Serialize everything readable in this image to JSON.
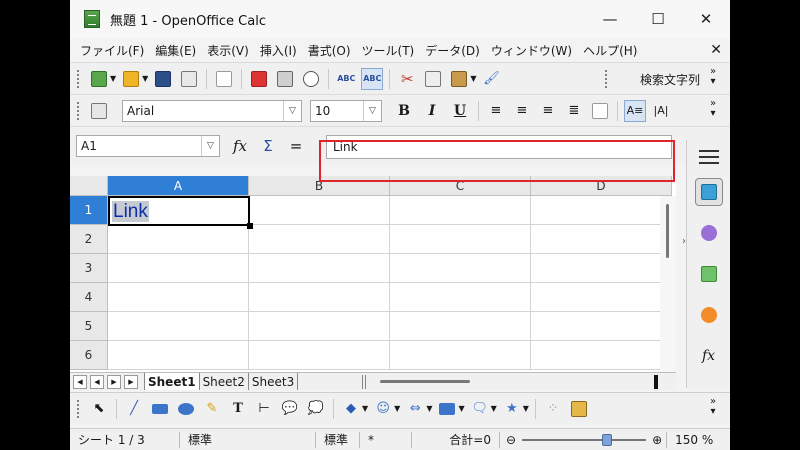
{
  "window": {
    "title": "無題 1 - OpenOffice Calc",
    "controls": {
      "minimize": "—",
      "maximize": "☐",
      "close": "✕"
    }
  },
  "menubar": {
    "items": [
      "ファイル(F)",
      "編集(E)",
      "表示(V)",
      "挿入(I)",
      "書式(O)",
      "ツール(T)",
      "データ(D)",
      "ウィンドウ(W)",
      "ヘルプ(H)"
    ],
    "close": "✕"
  },
  "standard_toolbar": {
    "find_label": "検索文字列",
    "buttons": [
      "new-icon",
      "open-icon",
      "save-icon",
      "email-icon",
      "edit-file-icon",
      "export-pdf-icon",
      "print-icon",
      "page-preview-icon",
      "spellcheck-icon",
      "autospellcheck-icon",
      "cut-icon",
      "copy-icon",
      "paste-icon",
      "format-paintbrush-icon"
    ]
  },
  "format_toolbar": {
    "font_name": "Arial",
    "font_size": "10",
    "bold": "B",
    "italic": "I",
    "underline": "U"
  },
  "formula_bar": {
    "name_box": "A1",
    "fx": "fx",
    "sum": "Σ",
    "equals": "=",
    "input_value": "Link"
  },
  "grid": {
    "columns": [
      "A",
      "B",
      "C",
      "D"
    ],
    "rows": [
      "1",
      "2",
      "3",
      "4",
      "5",
      "6"
    ],
    "active_cell_text": "Link"
  },
  "sheets": {
    "tabs": [
      "Sheet1",
      "Sheet2",
      "Sheet3"
    ],
    "active": "Sheet1"
  },
  "statusbar": {
    "sheet": "シート 1 / 3",
    "style": "標準",
    "mode": "標準",
    "modified": "*",
    "sum": "合計=0",
    "zoom": "150 %",
    "zoom_percent": 150
  },
  "colors": {
    "selection_header": "#2f7fd6",
    "highlight_box": "#e0242b",
    "cell_text": "#0b2ea8"
  }
}
